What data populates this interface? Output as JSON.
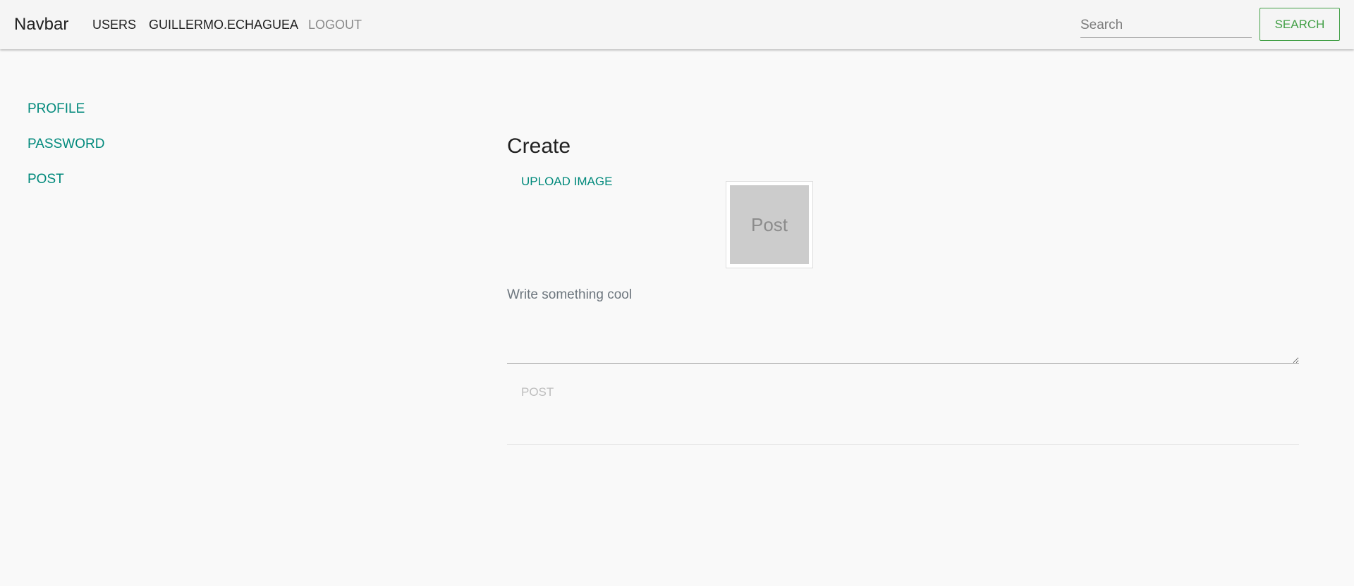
{
  "navbar": {
    "brand": "Navbar",
    "links": {
      "users": "USERS",
      "user": "GUILLERMO.ECHAGUEA",
      "logout": "LOGOUT"
    },
    "search": {
      "placeholder": "Search",
      "value": "",
      "button_label": "SEARCH"
    },
    "colors": {
      "search_accent": "#43a047"
    }
  },
  "sidebar": {
    "items": [
      {
        "label": "PROFILE"
      },
      {
        "label": "PASSWORD"
      },
      {
        "label": "POST"
      }
    ],
    "link_color": "#00897b"
  },
  "main": {
    "title": "Create",
    "upload_label": "UPLOAD IMAGE",
    "preview_text": "Post",
    "textarea": {
      "placeholder": "Write something cool",
      "value": ""
    },
    "post_button_label": "POST",
    "post_button_disabled": true
  }
}
